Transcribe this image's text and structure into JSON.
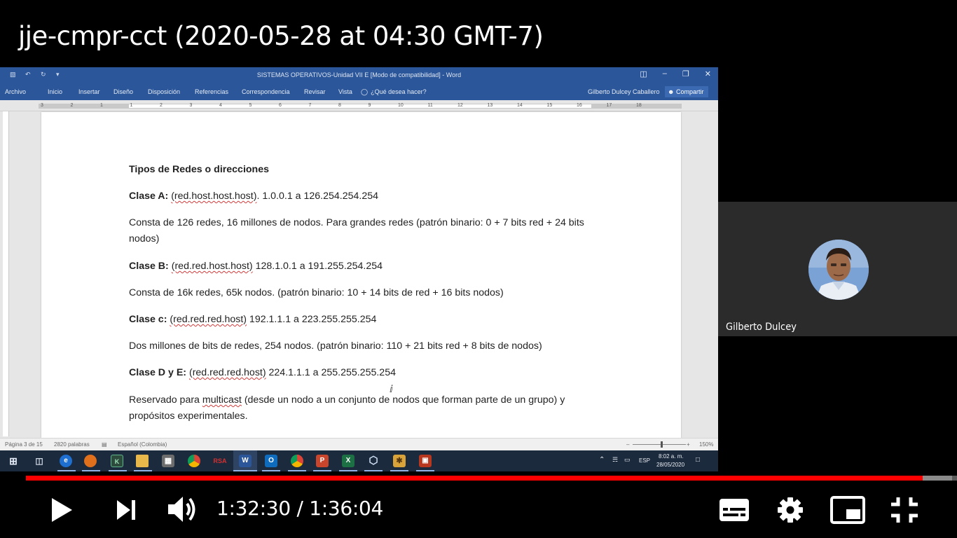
{
  "video": {
    "title": "jje-cmpr-cct (2020-05-28 at 04:30 GMT-7)",
    "current_time": "1:32:30",
    "separator": " / ",
    "duration": "1:36:04",
    "progress_played": 0.9633,
    "progress_loaded": 0.995
  },
  "word": {
    "doc_title": "SISTEMAS OPERATIVOS-Unidad VII E [Modo de compatibilidad] - Word",
    "tabs": [
      "Archivo",
      "Inicio",
      "Insertar",
      "Diseño",
      "Disposición",
      "Referencias",
      "Correspondencia",
      "Revisar",
      "Vista",
      "¿Qué desea hacer?"
    ],
    "user": "Gilberto Dulcey Caballero",
    "share": "Compartir",
    "ruler_numbers": [
      "3",
      "2",
      "1",
      "1",
      "2",
      "3",
      "4",
      "5",
      "6",
      "7",
      "8",
      "9",
      "10",
      "11",
      "12",
      "13",
      "14",
      "15",
      "16",
      "17",
      "18"
    ],
    "status": {
      "page": "Página 3 de 15",
      "words": "2820 palabras",
      "language": "Español (Colombia)",
      "zoom": "150%"
    }
  },
  "document": {
    "heading": "Tipos de Redes o direcciones",
    "clase_a": {
      "label": "Clase A:",
      "pattern": "(red.host.host.host)",
      "range": ". 1.0.0.1  a   126.254.254.254"
    },
    "desc_a": "Consta de 126 redes, 16 millones de nodos. Para grandes redes (patrón binario: 0 + 7 bits red + 24 bits nodos)",
    "clase_b": {
      "label": "Clase B:",
      "pattern": "(red.red.host.host)",
      "range": " 128.1.0.1  a   191.255.254.254"
    },
    "desc_b": "Consta de 16k redes, 65k nodos.  (patrón binario: 10 + 14 bits de red + 16 bits nodos)",
    "clase_c": {
      "label": "Clase c:",
      "pattern": "(red.red.red.host)",
      "range": " 192.1.1.1  a  223.255.255.254"
    },
    "desc_c": "Dos millones de bits de redes, 254 nodos. (patrón binario: 110 + 21 bits red + 8 bits de nodos)",
    "clase_de": {
      "label": "Clase D y E:",
      "pattern": "(red.red.red.host)",
      "range": " 224.1.1.1  a  255.255.255.254"
    },
    "desc_de_1": "Reservado para ",
    "desc_de_word": "multicast",
    "desc_de_2": " (desde un nodo a un conjunto de nodos que forman parte de un grupo) y propósitos experimentales."
  },
  "taskbar": {
    "icons": [
      "windows-start",
      "task-view",
      "edge",
      "firefox",
      "cmd",
      "file-explorer",
      "calculator",
      "chrome",
      "rsa",
      "word",
      "outlook",
      "chrome",
      "powerpoint",
      "excel",
      "3d-viewer",
      "tools",
      "app"
    ],
    "rsa_label": "RSA",
    "language": "ESP",
    "time": "8:02 a. m.",
    "date": "28/05/2020"
  },
  "participant": {
    "name": "Gilberto Dulcey"
  },
  "colors": {
    "word_blue": "#2b579a",
    "progress_red": "#ff0000",
    "participant_bg": "#2b2b2b"
  }
}
